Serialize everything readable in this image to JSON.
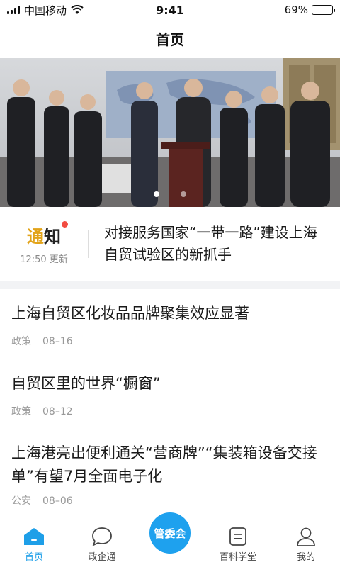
{
  "status_bar": {
    "carrier": "中国移动",
    "time": "9:41",
    "battery": "69%",
    "battery_level": 0.69
  },
  "header": {
    "title": "首页"
  },
  "banner": {
    "slide_count": 2,
    "active_index": 0
  },
  "notice": {
    "badge_first": "通",
    "badge_rest": "知",
    "time": "12:50 更新",
    "text": "对接服务国家“一带一路”建设上海自贸试验区的新抓手"
  },
  "articles": [
    {
      "title": "上海自贸区化妆品品牌聚集效应显著",
      "category": "政策",
      "date": "08–16"
    },
    {
      "title": "自贸区里的世界“橱窗”",
      "category": "政策",
      "date": "08–12"
    },
    {
      "title": "上海港亮出便利通关“营商牌”“集装箱设备交接单”有望7月全面电子化",
      "category": "公安",
      "date": "08–06"
    }
  ],
  "tabs": [
    {
      "label": "首页",
      "icon": "home-icon",
      "active": true
    },
    {
      "label": "政企通",
      "icon": "chat-bubble-icon",
      "active": false
    },
    {
      "label": "管委会",
      "icon": "center-circle-icon",
      "active": false
    },
    {
      "label": "百科学堂",
      "icon": "book-icon",
      "active": false
    },
    {
      "label": "我的",
      "icon": "user-icon",
      "active": false
    }
  ],
  "colors": {
    "accent": "#1e9fe8",
    "notice_orange": "#e2a319",
    "notice_red": "#f24c41"
  }
}
